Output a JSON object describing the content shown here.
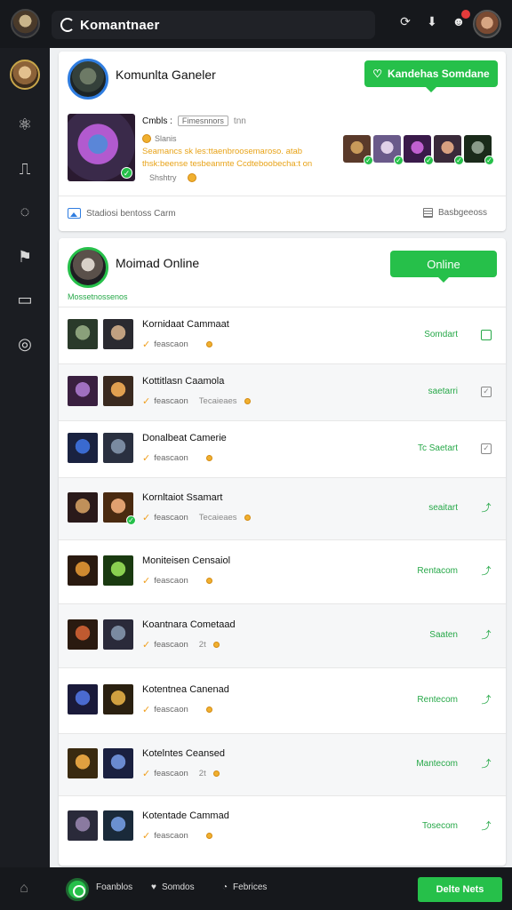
{
  "header": {
    "app_title": "Komantnaer",
    "icons": [
      "refresh-icon",
      "download-icon",
      "notification-icon"
    ]
  },
  "sidebar": {
    "icons": [
      "network-icon",
      "profile-card-icon",
      "chat-icon",
      "flag-icon",
      "inbox-icon",
      "settings-icon"
    ]
  },
  "card1": {
    "title": "Komunlta Ganeler",
    "button_label": "Kandehas Somdane",
    "meta_label": "Cmbls :",
    "meta_box": "Fimesnnors",
    "meta_suffix": "tnn",
    "status": "Slanis",
    "description": "Seamancs sk les:ttaenbroosemaroso. atab thsk:beense tesbeanmte Ccdteboobecha:t on",
    "shiny": "Shshtry",
    "footer_left": "Stadiosi bentoss Carm",
    "footer_right": "Basbgeeoss"
  },
  "card2": {
    "title": "Moimad Online",
    "button_label": "Online",
    "subtitle": "Mossetnossenos"
  },
  "rows": [
    {
      "name": "Kornidaat Cammaat",
      "meta": "feascaon",
      "extra": "",
      "status": "Somdart",
      "icon": "box"
    },
    {
      "name": "Kottitlasn Caamola",
      "meta": "feascaon",
      "extra": "Tecaieaes",
      "status": "saetarri",
      "icon": "box2"
    },
    {
      "name": "Donalbeat Camerie",
      "meta": "feascaon",
      "extra": "",
      "status": "Tc Saetart",
      "icon": "box2"
    },
    {
      "name": "Kornltaiot Ssamart",
      "meta": "feascaon",
      "extra": "Tecaieaes",
      "status": "seaitart",
      "icon": "tick"
    },
    {
      "name": "Moniteisen Censaiol",
      "meta": "feascaon",
      "extra": "",
      "status": "Rentacom",
      "icon": "tick"
    },
    {
      "name": "Koantnara Cometaad",
      "meta": "feascaon",
      "extra": "2t",
      "status": "Saaten",
      "icon": "tick"
    },
    {
      "name": "Kotentnea Canenad",
      "meta": "feascaon",
      "extra": "",
      "status": "Rentecom",
      "icon": "tick"
    },
    {
      "name": "Kotelntes Ceansed",
      "meta": "feascaon",
      "extra": "2t",
      "status": "Mantecom",
      "icon": "tick"
    },
    {
      "name": "Kotentade Cammad",
      "meta": "feascaon",
      "extra": "",
      "status": "Tosecom",
      "icon": "tick"
    }
  ],
  "bottom": {
    "item1": "Foanblos",
    "item2": "Somdos",
    "item3": "Febrices",
    "button_label": "Delte Nets"
  }
}
